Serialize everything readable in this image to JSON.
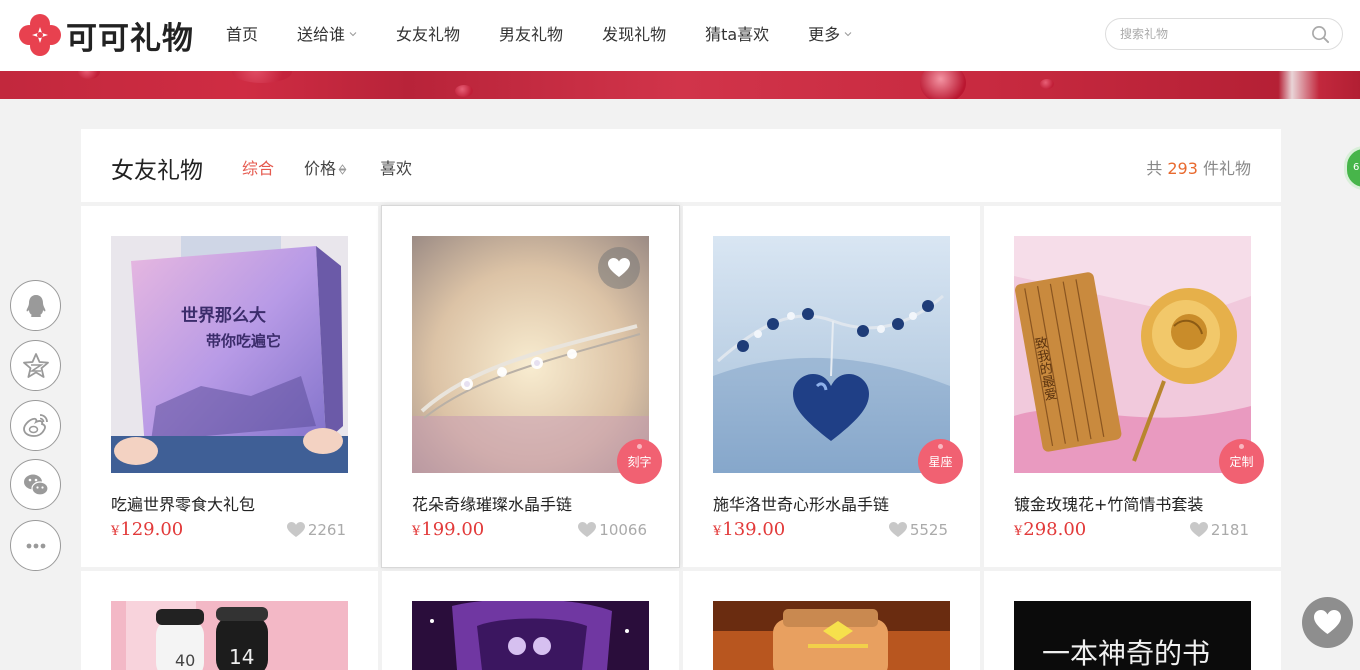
{
  "brand": {
    "name": "可可礼物",
    "logo_icon": "clover-logo-icon",
    "accent": "#e8414f"
  },
  "nav": {
    "items": [
      {
        "label": "首页",
        "dropdown": false
      },
      {
        "label": "送给谁",
        "dropdown": true
      },
      {
        "label": "女友礼物",
        "dropdown": false
      },
      {
        "label": "男友礼物",
        "dropdown": false
      },
      {
        "label": "发现礼物",
        "dropdown": false
      },
      {
        "label": "猜ta喜欢",
        "dropdown": false
      },
      {
        "label": "更多",
        "dropdown": true
      }
    ]
  },
  "search": {
    "placeholder": "搜索礼物",
    "icon": "search-icon"
  },
  "listing": {
    "title": "女友礼物",
    "sort_tabs": [
      {
        "label": "综合",
        "active": true
      },
      {
        "label": "价格",
        "active": false,
        "icon": "sort-arrows-icon"
      },
      {
        "label": "喜欢",
        "active": false
      }
    ],
    "count_prefix": "共",
    "count": "293",
    "count_suffix": "件礼物"
  },
  "products": [
    {
      "title": "吃遍世界零食大礼包",
      "yen": "¥",
      "price": "129.00",
      "likes": "2261",
      "tag": "",
      "image": "purple-gift-box-photo"
    },
    {
      "title": "花朵奇缘璀璨水晶手链",
      "yen": "¥",
      "price": "199.00",
      "likes": "10066",
      "tag": "刻字",
      "image": "flower-crystal-bracelet-photo",
      "hover": true
    },
    {
      "title": "施华洛世奇心形水晶手链",
      "yen": "¥",
      "price": "139.00",
      "likes": "5525",
      "tag": "星座",
      "image": "blue-heart-bracelet-photo"
    },
    {
      "title": "镀金玫瑰花+竹简情书套装",
      "yen": "¥",
      "price": "298.00",
      "likes": "2181",
      "tag": "定制",
      "image": "gold-rose-bamboo-scroll-photo"
    },
    {
      "image": "thermos-bottles-photo"
    },
    {
      "image": "heart-crystal-photo-frame-photo"
    },
    {
      "image": "wish-jar-photo"
    },
    {
      "image": "magic-book-photo",
      "image_text": "一本神奇的书"
    }
  ],
  "share_bar": [
    "qq-icon",
    "qzone-star-icon",
    "weibo-icon",
    "wechat-icon",
    "more-dots-icon"
  ],
  "float": {
    "heart": "heart-icon",
    "green_badge": "6"
  }
}
